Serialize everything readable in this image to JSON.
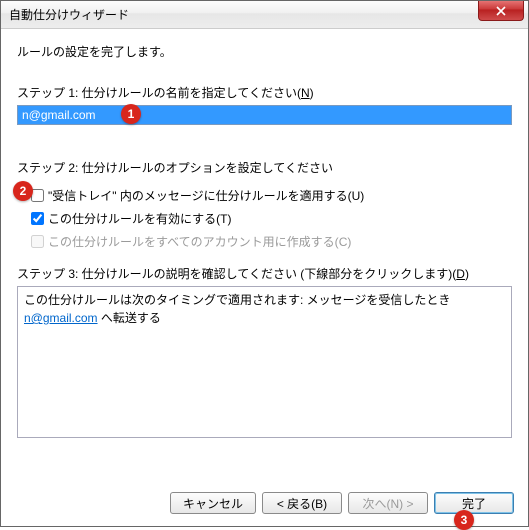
{
  "title": "自動仕分けウィザード",
  "intro": "ルールの設定を完了します。",
  "step1": {
    "label_pre": "ステップ 1: 仕分けルールの名前を指定してください(",
    "label_u": "N",
    "label_post": ")",
    "value": "n@gmail.com"
  },
  "step2": {
    "label": "ステップ 2: 仕分けルールのオプションを設定してください",
    "opt1_checked": false,
    "opt1_pre": "\"受信トレイ\" 内のメッセージに仕分けルールを適用する(",
    "opt1_u": "U",
    "opt1_post": ")",
    "opt2_checked": true,
    "opt2_pre": "この仕分けルールを有効にする(",
    "opt2_u": "T",
    "opt2_post": ")",
    "opt3_checked": false,
    "opt3_pre": "この仕分けルールをすべてのアカウント用に作成する(",
    "opt3_u": "C",
    "opt3_post": ")"
  },
  "step3": {
    "label_pre": "ステップ 3: 仕分けルールの説明を確認してください (下線部分をクリックします)(",
    "label_u": "D",
    "label_post": ")",
    "desc_line1": "この仕分けルールは次のタイミングで適用されます: メッセージを受信したとき",
    "desc_link": "n@gmail.com",
    "desc_after": " へ転送する"
  },
  "buttons": {
    "cancel": "キャンセル",
    "back": "< 戻る(B)",
    "next": "次へ(N) >",
    "finish": "完了"
  },
  "badges": {
    "b1": "1",
    "b2": "2",
    "b3": "3"
  }
}
